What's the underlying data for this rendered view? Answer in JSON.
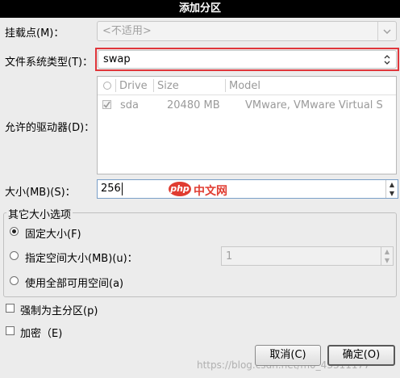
{
  "window": {
    "title": "添加分区"
  },
  "mount_point": {
    "label": "挂载点(M)：",
    "value": "<不适用>"
  },
  "fs_type": {
    "label": "文件系统类型(T)：",
    "value": "swap"
  },
  "drives": {
    "label": "允许的驱动器(D)：",
    "columns": [
      "Drive",
      "Size",
      "Model"
    ],
    "rows": [
      {
        "drive": "sda",
        "size": "20480 MB",
        "model": "VMware, VMware Virtual S"
      }
    ]
  },
  "size": {
    "label": "大小(MB)(S)：",
    "value": "256"
  },
  "other_options": {
    "title": "其它大小选项",
    "fixed": "固定大小(F)",
    "fill_to": "指定空间大小(MB)(u)：",
    "fill_to_value": "1",
    "fill_all": "使用全部可用空间(a)"
  },
  "force_primary": {
    "label": "强制为主分区(p)"
  },
  "encrypt": {
    "label": "加密（E)"
  },
  "buttons": {
    "cancel": "取消(C)",
    "ok": "确定(O)"
  },
  "overlay": {
    "logo_badge": "php",
    "logo_text": "中文网",
    "watermark": "https://blog.csdn.net/m0_43311177"
  }
}
